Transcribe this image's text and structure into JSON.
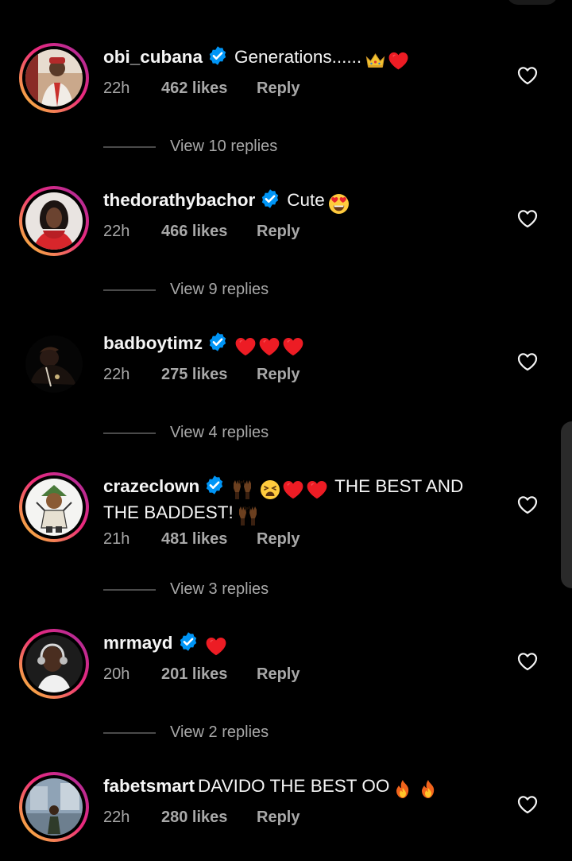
{
  "comments": [
    {
      "username": "obi_cubana",
      "verified": true,
      "text": "Generations......",
      "emojis": [
        "crown",
        "red-heart"
      ],
      "time": "22h",
      "likes": "462 likes",
      "reply": "Reply",
      "view_replies": "View 10 replies"
    },
    {
      "username": "thedorathybachor",
      "verified": true,
      "text": "Cute",
      "emojis": [
        "heart-eyes"
      ],
      "time": "22h",
      "likes": "466 likes",
      "reply": "Reply",
      "view_replies": "View 9 replies"
    },
    {
      "username": "badboytimz",
      "verified": true,
      "text": "",
      "emojis": [
        "red-heart",
        "red-heart",
        "red-heart"
      ],
      "time": "22h",
      "likes": "275 likes",
      "reply": "Reply",
      "view_replies": "View 4 replies"
    },
    {
      "username": "crazeclown",
      "verified": true,
      "text_line1": "THE BEST AND",
      "text_line2": "THE BADDEST!",
      "emojis": [
        "raising-hands",
        "weary-face",
        "red-heart",
        "red-heart",
        "raising-hands"
      ],
      "time": "21h",
      "likes": "481 likes",
      "reply": "Reply",
      "view_replies": "View 3 replies"
    },
    {
      "username": "mrmayd",
      "verified": true,
      "text": "",
      "emojis": [
        "red-heart"
      ],
      "time": "20h",
      "likes": "201 likes",
      "reply": "Reply",
      "view_replies": "View 2 replies"
    },
    {
      "username": "fabetsmart",
      "verified": false,
      "text": "DAVIDO THE BEST OO",
      "emojis": [
        "fire",
        "fire"
      ],
      "time": "22h",
      "likes": "280 likes",
      "reply": "Reply"
    }
  ],
  "colors": {
    "background": "#000000",
    "text": "#f5f5f5",
    "meta": "#a8a8a8",
    "verified": "#0095f6",
    "heart": "#ed1c24"
  }
}
